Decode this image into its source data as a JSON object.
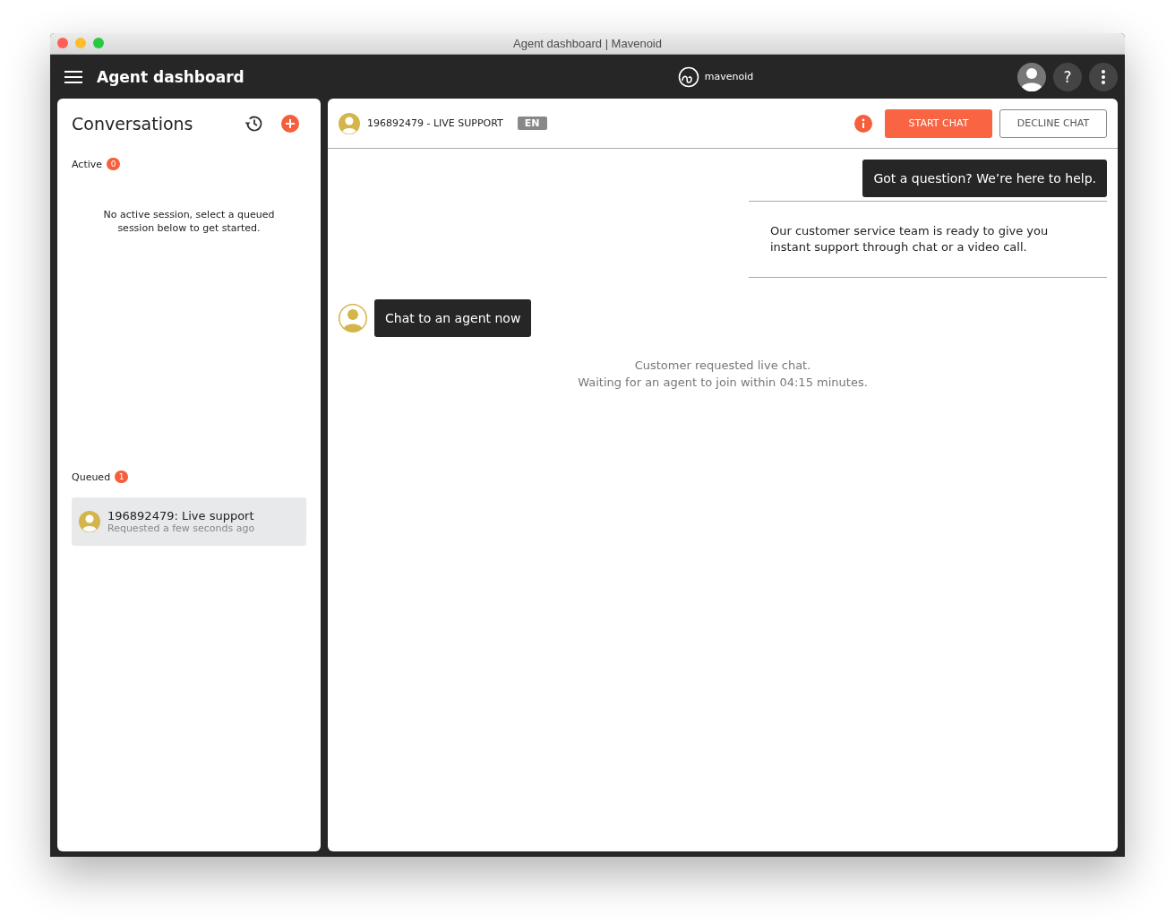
{
  "window": {
    "title": "Agent dashboard | Mavenoid"
  },
  "app_bar": {
    "title": "Agent dashboard",
    "logo_text": "mavenoid",
    "help_label": "?"
  },
  "conversations": {
    "title": "Conversations",
    "active": {
      "label": "Active",
      "count": "0",
      "empty_text": "No active session, select a queued session below to get started."
    },
    "queued": {
      "label": "Queued",
      "count": "1",
      "items": [
        {
          "title": "196892479: Live support",
          "subtitle": "Requested a few seconds ago",
          "selected": true
        }
      ]
    }
  },
  "chat": {
    "header": {
      "title": "196892479 - LIVE SUPPORT",
      "language": "EN",
      "start_button": "START CHAT",
      "decline_button": "DECLINE CHAT"
    },
    "messages": [
      {
        "kind": "bot",
        "text": "Got a question? We’re here to help."
      },
      {
        "kind": "card",
        "text": "Our customer service team is ready to give you instant support through chat or a video call."
      },
      {
        "kind": "user",
        "text": "Chat to an agent now"
      },
      {
        "kind": "system",
        "lines": [
          "Customer requested live chat.",
          "Waiting for an agent to join within 04:15 minutes."
        ]
      }
    ]
  }
}
